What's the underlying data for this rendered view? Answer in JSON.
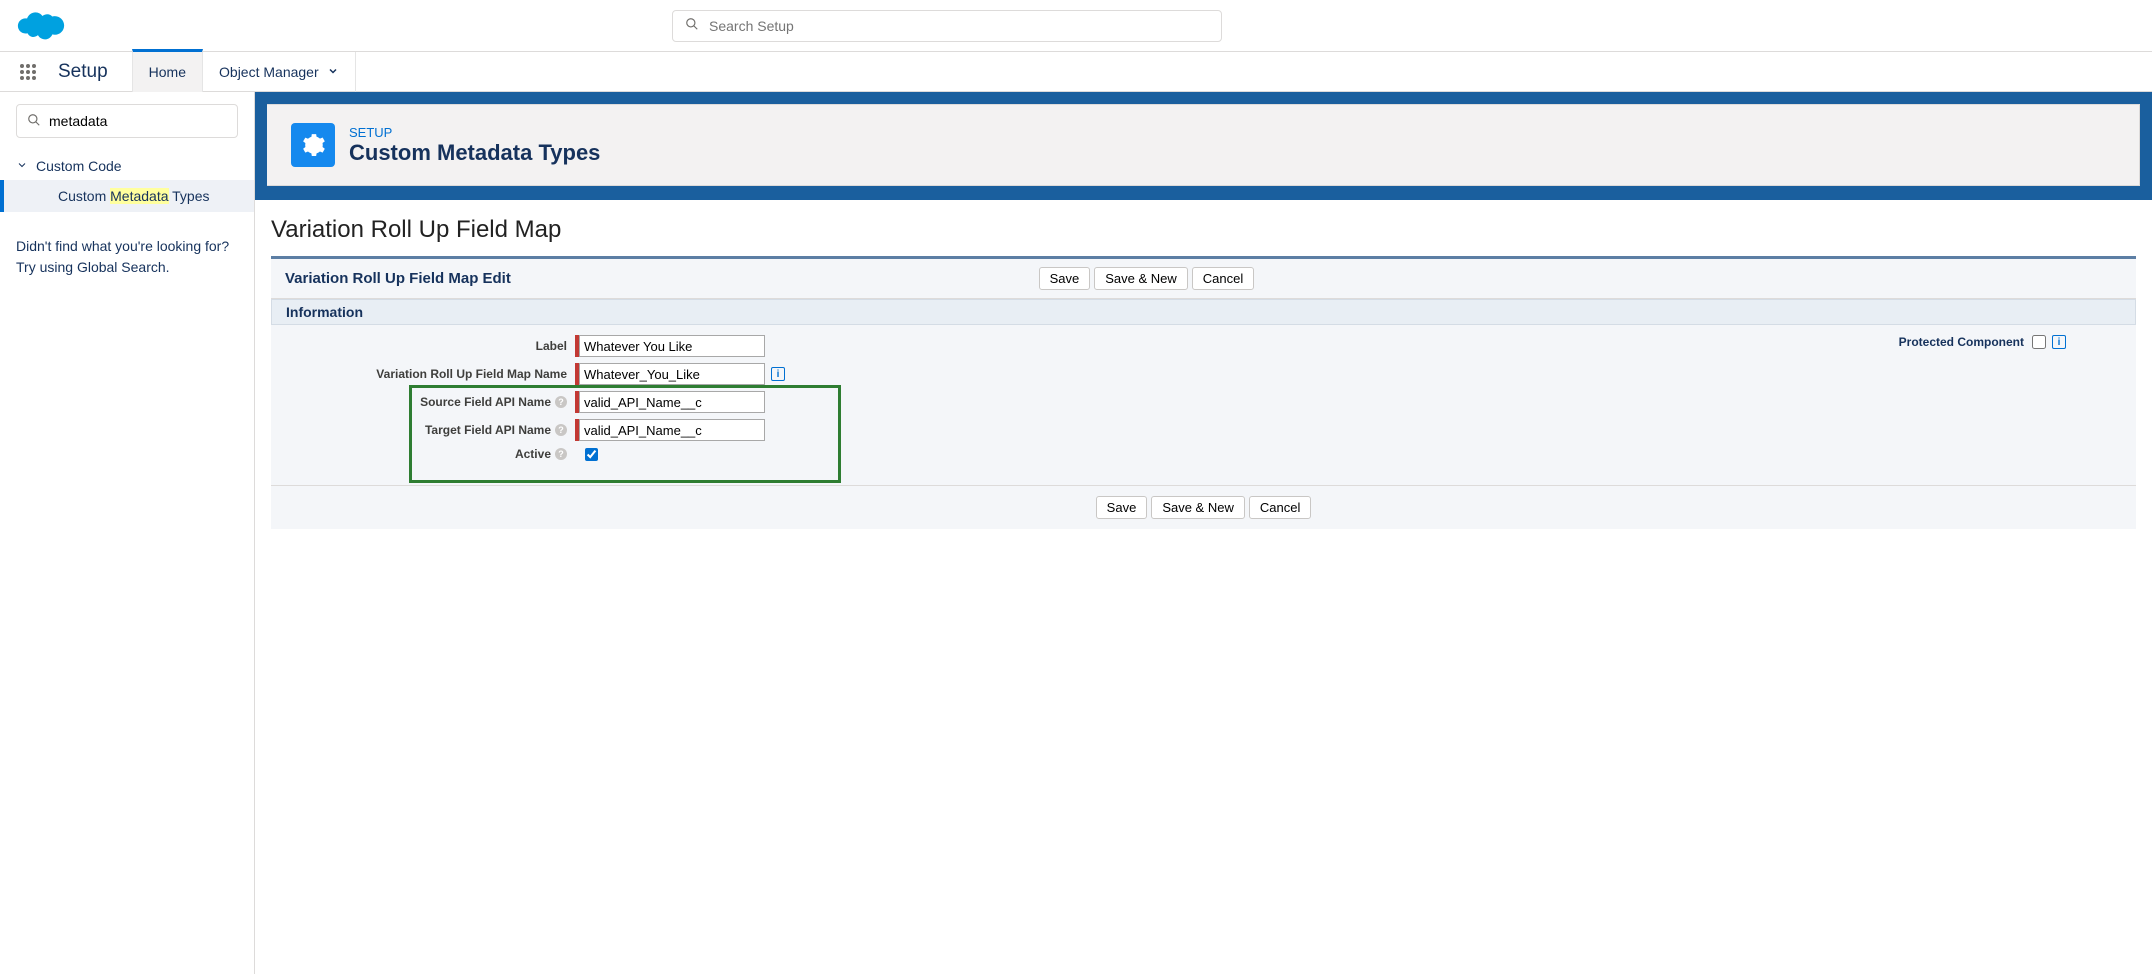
{
  "header": {
    "search_placeholder": "Search Setup",
    "setup_label": "Setup",
    "tabs": {
      "home": "Home",
      "om": "Object Manager"
    }
  },
  "sidebar": {
    "search_value": "metadata",
    "node": "Custom Code",
    "leaf_pre": "Custom ",
    "leaf_hl": "Metadata",
    "leaf_post": " Types",
    "help1": "Didn't find what you're looking for?",
    "help2": "Try using Global Search."
  },
  "page": {
    "breadcrumb": "SETUP",
    "title": "Custom Metadata Types"
  },
  "detail": {
    "title": "Variation Roll Up Field Map",
    "edit_title": "Variation Roll Up Field Map Edit",
    "info": "Information",
    "buttons": {
      "save": "Save",
      "savenew": "Save & New",
      "cancel": "Cancel"
    },
    "fields": {
      "label_lbl": "Label",
      "label_val": "Whatever You Like",
      "name_lbl": "Variation Roll Up Field Map Name",
      "name_val": "Whatever_You_Like",
      "source_lbl": "Source Field API Name",
      "source_val": "valid_API_Name__c",
      "target_lbl": "Target Field API Name",
      "target_val": "valid_API_Name__c",
      "active_lbl": "Active",
      "protected_lbl": "Protected Component"
    }
  }
}
